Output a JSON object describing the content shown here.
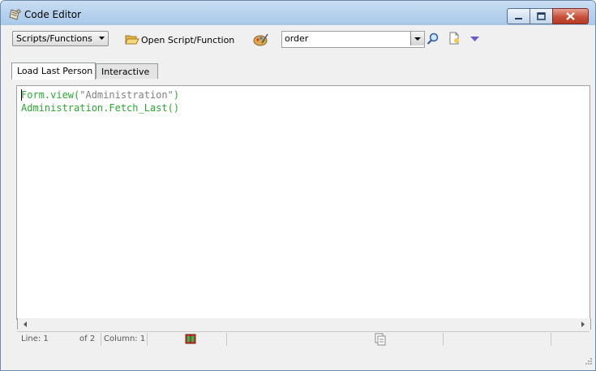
{
  "window": {
    "title": "Code Editor"
  },
  "toolbar": {
    "mode_select": "Scripts/Functions",
    "open_label": "Open Script/Function",
    "search_value": "order"
  },
  "tabs": [
    {
      "label": "Load Last Person",
      "active": true
    },
    {
      "label": "Interactive",
      "active": false
    }
  ],
  "editor": {
    "lines": [
      {
        "obj": "Form.view(",
        "str": "\"Administration\"",
        "end": ")"
      },
      {
        "obj": "Administration.Fetch_Last()",
        "str": "",
        "end": ""
      }
    ]
  },
  "status": {
    "line": "Line: 1",
    "of": "of 2",
    "column": "Column: 1"
  },
  "colors": {
    "code_keyword": "#2aa832",
    "code_string": "#808080",
    "titlebar": "#b7d2ee"
  },
  "icons": [
    "scroll-icon",
    "folder-open-icon",
    "palette-icon",
    "magnify-icon",
    "new-page-icon",
    "down-triangle-icon",
    "book-icon",
    "page-copy-icon"
  ]
}
